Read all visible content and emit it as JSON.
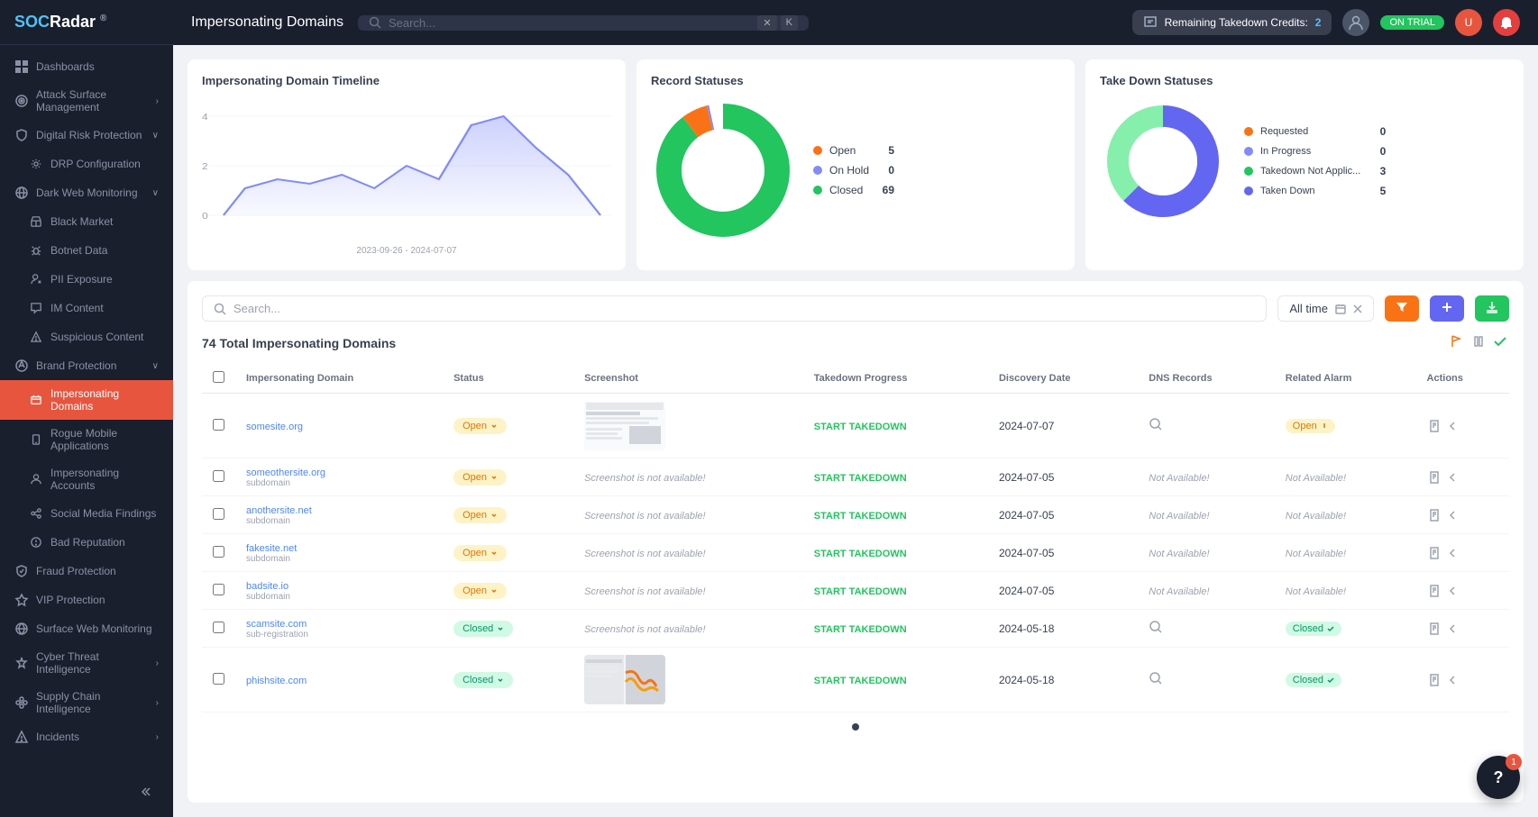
{
  "sidebar": {
    "logo": "SOCRadar",
    "items": [
      {
        "id": "dashboards",
        "label": "Dashboards",
        "icon": "grid",
        "indent": 0,
        "hasChevron": false
      },
      {
        "id": "attack-surface",
        "label": "Attack Surface Management",
        "icon": "target",
        "indent": 0,
        "hasChevron": true
      },
      {
        "id": "digital-risk",
        "label": "Digital Risk Protection",
        "icon": "shield",
        "indent": 0,
        "hasChevron": true
      },
      {
        "id": "drp-config",
        "label": "DRP Configuration",
        "icon": "settings",
        "indent": 1,
        "hasChevron": false
      },
      {
        "id": "dark-web",
        "label": "Dark Web Monitoring",
        "icon": "globe",
        "indent": 0,
        "hasChevron": true
      },
      {
        "id": "black-market",
        "label": "Black Market",
        "icon": "store",
        "indent": 1,
        "hasChevron": false
      },
      {
        "id": "botnet-data",
        "label": "Botnet Data",
        "icon": "bug",
        "indent": 1,
        "hasChevron": false
      },
      {
        "id": "pii-exposure",
        "label": "PII Exposure",
        "icon": "user-x",
        "indent": 1,
        "hasChevron": false
      },
      {
        "id": "im-content",
        "label": "IM Content",
        "icon": "message",
        "indent": 1,
        "hasChevron": false
      },
      {
        "id": "suspicious-content",
        "label": "Suspicious Content",
        "icon": "alert",
        "indent": 1,
        "hasChevron": false
      },
      {
        "id": "brand-protection",
        "label": "Brand Protection",
        "icon": "brand",
        "indent": 0,
        "hasChevron": true
      },
      {
        "id": "impersonating-domains",
        "label": "Impersonating Domains",
        "icon": "domain",
        "indent": 1,
        "hasChevron": false,
        "active": true
      },
      {
        "id": "rogue-mobile",
        "label": "Rogue Mobile Applications",
        "icon": "mobile",
        "indent": 1,
        "hasChevron": false
      },
      {
        "id": "impersonating-accounts",
        "label": "Impersonating Accounts",
        "icon": "account",
        "indent": 1,
        "hasChevron": false
      },
      {
        "id": "social-media",
        "label": "Social Media Findings",
        "icon": "social",
        "indent": 1,
        "hasChevron": false
      },
      {
        "id": "bad-reputation",
        "label": "Bad Reputation",
        "icon": "reputation",
        "indent": 1,
        "hasChevron": false
      },
      {
        "id": "fraud-protection",
        "label": "Fraud Protection",
        "icon": "fraud",
        "indent": 0,
        "hasChevron": false
      },
      {
        "id": "vip-protection",
        "label": "VIP Protection",
        "icon": "vip",
        "indent": 0,
        "hasChevron": false
      },
      {
        "id": "surface-web",
        "label": "Surface Web Monitoring",
        "icon": "web",
        "indent": 0,
        "hasChevron": false
      },
      {
        "id": "cyber-threat",
        "label": "Cyber Threat Intelligence",
        "icon": "threat",
        "indent": 0,
        "hasChevron": true
      },
      {
        "id": "supply-chain",
        "label": "Supply Chain Intelligence",
        "icon": "chain",
        "indent": 0,
        "hasChevron": true
      },
      {
        "id": "incidents",
        "label": "Incidents",
        "icon": "incident",
        "indent": 0,
        "hasChevron": true
      }
    ]
  },
  "topbar": {
    "page_title": "Impersonating Domains",
    "search_placeholder": "Search...",
    "trial_label": "ON TRIAL",
    "credits_label": "Remaining Takedown Credits:",
    "credits_count": "2"
  },
  "charts": {
    "timeline": {
      "title": "Impersonating Domain Timeline",
      "date_range": "2023-09-26 - 2024-07-07",
      "y_labels": [
        "4",
        "2",
        "0"
      ]
    },
    "record_statuses": {
      "title": "Record Statuses",
      "items": [
        {
          "label": "Open",
          "count": 5,
          "color": "#f97316"
        },
        {
          "label": "On Hold",
          "count": 0,
          "color": "#818cf8"
        },
        {
          "label": "Closed",
          "count": 69,
          "color": "#22c55e"
        }
      ]
    },
    "takedown_statuses": {
      "title": "Take Down Statuses",
      "items": [
        {
          "label": "Requested",
          "count": 0,
          "color": "#f97316"
        },
        {
          "label": "In Progress",
          "count": 0,
          "color": "#818cf8"
        },
        {
          "label": "Takedown Not Applic...",
          "count": 3,
          "color": "#22c55e"
        },
        {
          "label": "Taken Down",
          "count": 5,
          "color": "#6366f1"
        }
      ]
    }
  },
  "table": {
    "total_label": "74 Total Impersonating Domains",
    "search_placeholder": "Search...",
    "date_filter_label": "All time",
    "columns": [
      "Impersonating Domain",
      "Status",
      "Screenshot",
      "Takedown Progress",
      "Discovery Date",
      "DNS Records",
      "Related Alarm",
      "Actions"
    ],
    "rows": [
      {
        "domain": "somesite.org",
        "subdomain": "",
        "status": "Open",
        "has_screenshot": true,
        "takedown": "START TAKEDOWN",
        "discovery_date": "2024-07-07",
        "dns_records": "search",
        "related_alarm": "Open",
        "related_alarm_type": "open"
      },
      {
        "domain": "someothersite.org",
        "subdomain": "subdomain",
        "status": "Open",
        "has_screenshot": false,
        "screenshot_text": "Screenshot is not available!",
        "takedown": "START TAKEDOWN",
        "discovery_date": "2024-07-05",
        "dns_records": "Not Available!",
        "related_alarm": "Not Available!",
        "related_alarm_type": "none"
      },
      {
        "domain": "anothersite.net",
        "subdomain": "subdomain",
        "status": "Open",
        "has_screenshot": false,
        "screenshot_text": "Screenshot is not available!",
        "takedown": "START TAKEDOWN",
        "discovery_date": "2024-07-05",
        "dns_records": "Not Available!",
        "related_alarm": "Not Available!",
        "related_alarm_type": "none"
      },
      {
        "domain": "fakesite.net",
        "subdomain": "subdomain",
        "status": "Open",
        "has_screenshot": false,
        "screenshot_text": "Screenshot is not available!",
        "takedown": "START TAKEDOWN",
        "discovery_date": "2024-07-05",
        "dns_records": "Not Available!",
        "related_alarm": "Not Available!",
        "related_alarm_type": "none"
      },
      {
        "domain": "badsite.io",
        "subdomain": "subdomain",
        "status": "Open",
        "has_screenshot": false,
        "screenshot_text": "Screenshot is not available!",
        "takedown": "START TAKEDOWN",
        "discovery_date": "2024-07-05",
        "dns_records": "Not Available!",
        "related_alarm": "Not Available!",
        "related_alarm_type": "none"
      },
      {
        "domain": "scamsite.com",
        "subdomain": "sub-registration",
        "status": "Closed",
        "has_screenshot": false,
        "screenshot_text": "Screenshot is not available!",
        "takedown": "START TAKEDOWN",
        "discovery_date": "2024-05-18",
        "dns_records": "search",
        "related_alarm": "Closed",
        "related_alarm_type": "closed"
      },
      {
        "domain": "phishsite.com",
        "subdomain": "",
        "status": "Closed",
        "has_screenshot": true,
        "takedown": "START TAKEDOWN",
        "discovery_date": "2024-05-18",
        "dns_records": "search",
        "related_alarm": "Closed",
        "related_alarm_type": "closed"
      }
    ]
  },
  "chat": {
    "icon": "?",
    "badge": "1"
  }
}
